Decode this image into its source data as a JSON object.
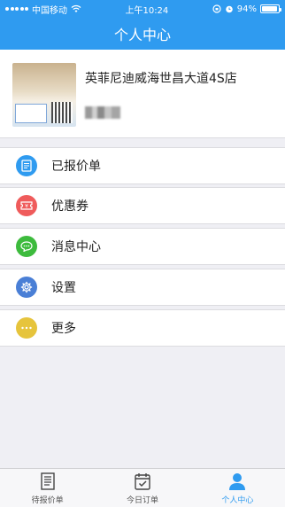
{
  "status_bar": {
    "carrier": "中国移动",
    "time": "上午10:24",
    "battery_text": "94%",
    "battery_level": 0.94
  },
  "nav": {
    "title": "个人中心"
  },
  "profile": {
    "name": "英菲尼迪威海世昌大道4S店"
  },
  "menu": [
    {
      "label": "已报价单",
      "icon": "quote-list-icon",
      "color": "#2f9bf0"
    },
    {
      "label": "优惠券",
      "icon": "coupon-icon",
      "color": "#ef5b5b"
    },
    {
      "label": "消息中心",
      "icon": "message-icon",
      "color": "#3dbb3d"
    },
    {
      "label": "设置",
      "icon": "gear-icon",
      "color": "#4a7fd6"
    },
    {
      "label": "更多",
      "icon": "more-icon",
      "color": "#e6c43c"
    }
  ],
  "tabs": [
    {
      "label": "待报价单",
      "icon": "document-icon",
      "active": false
    },
    {
      "label": "今日订单",
      "icon": "calendar-check-icon",
      "active": false
    },
    {
      "label": "个人中心",
      "icon": "person-icon",
      "active": true
    }
  ],
  "colors": {
    "accent": "#2f9bf0",
    "background": "#efeff4"
  }
}
